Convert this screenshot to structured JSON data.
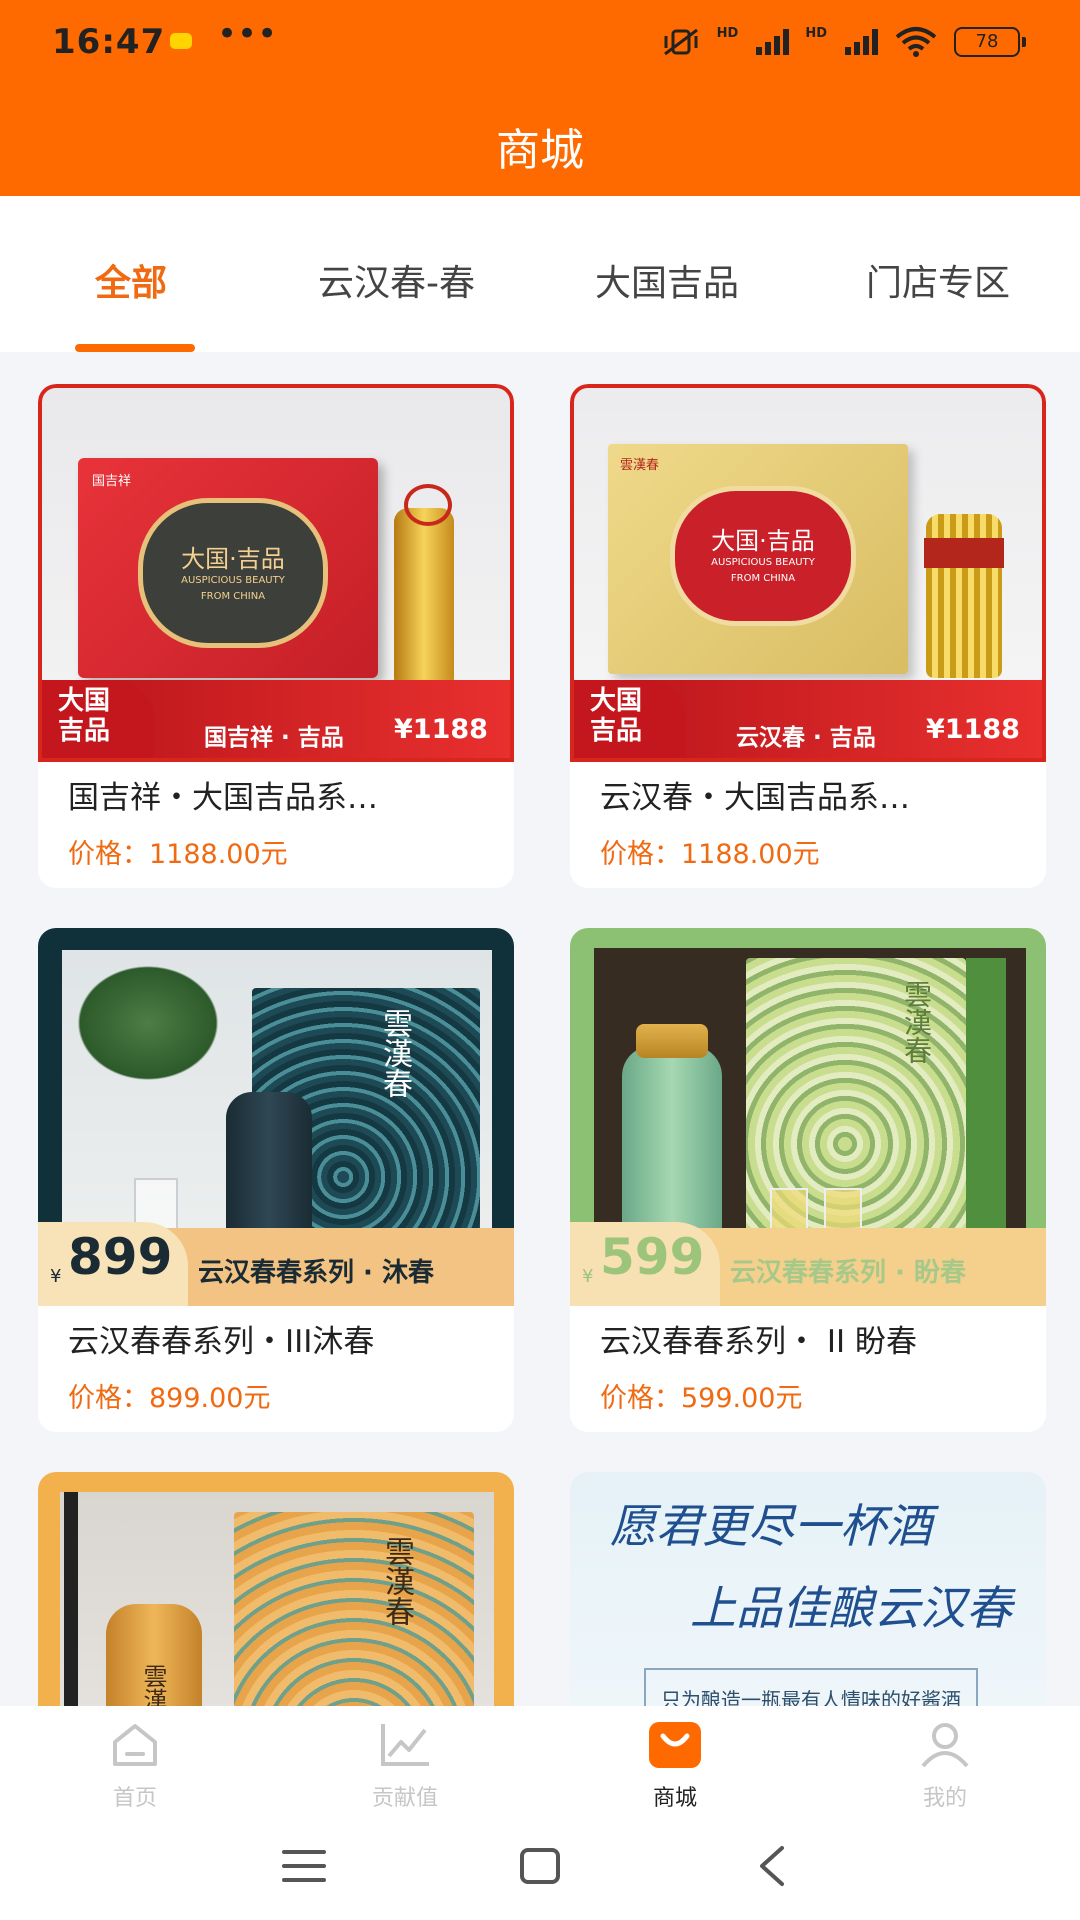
{
  "status_bar": {
    "time": "16:47",
    "more": "•••",
    "battery": "78",
    "hd1": "HD",
    "hd2": "HD"
  },
  "header": {
    "title": "商城"
  },
  "tabs": [
    {
      "label": "全部",
      "active": true
    },
    {
      "label": "云汉春-春",
      "active": false
    },
    {
      "label": "大国吉品",
      "active": false
    },
    {
      "label": "门店专区",
      "active": false
    }
  ],
  "products": [
    {
      "name": "国吉祥・大国吉品系…",
      "price": "价格：1188.00元",
      "art": {
        "badge": "大国\n吉品",
        "box_title": "大国·吉品",
        "box_sub1": "AUSPICIOUS BEAUTY",
        "box_sub2": "FROM CHINA",
        "brand": "国吉祥",
        "band_text": "国吉祥 · 吉品",
        "band_price": "¥1188"
      }
    },
    {
      "name": "云汉春・大国吉品系…",
      "price": "价格：1188.00元",
      "art": {
        "badge": "大国\n吉品",
        "box_title": "大国·吉品",
        "box_sub1": "AUSPICIOUS BEAUTY",
        "box_sub2": "FROM CHINA",
        "brand": "雲漢春",
        "band_text": "云汉春 · 吉品",
        "band_price": "¥1188"
      }
    },
    {
      "name": "云汉春春系列・III沐春",
      "price": "价格：899.00元",
      "art": {
        "yen": "¥",
        "big_price": "899",
        "band_text": "云汉春春系列 · 沐春",
        "box_text": "雲漢春"
      }
    },
    {
      "name": "云汉春春系列・ II 盼春",
      "price": "价格：599.00元",
      "art": {
        "yen": "¥",
        "big_price": "599",
        "band_text": "云汉春春系列 · 盼春",
        "box_text": "雲漢春"
      }
    },
    {
      "name": "",
      "price": "",
      "art": {
        "box_text": "雲漢春",
        "bottle_text": "雲漢"
      }
    },
    {
      "name": "",
      "price": "",
      "art": {
        "line1": "愿君更尽一杯酒",
        "line2": "上品佳酿云汉春",
        "line3": "只为酿造一瓶最有人情味的好酱酒"
      }
    }
  ],
  "bottom_nav": [
    {
      "label": "首页",
      "icon": "home-icon",
      "active": false
    },
    {
      "label": "贡献值",
      "icon": "chart-icon",
      "active": false
    },
    {
      "label": "商城",
      "icon": "shop-bag-icon",
      "active": true
    },
    {
      "label": "我的",
      "icon": "user-icon",
      "active": false
    }
  ],
  "colors": {
    "brand": "#ff6a00",
    "price": "#f06a12",
    "inactive": "#c6c6c6"
  }
}
